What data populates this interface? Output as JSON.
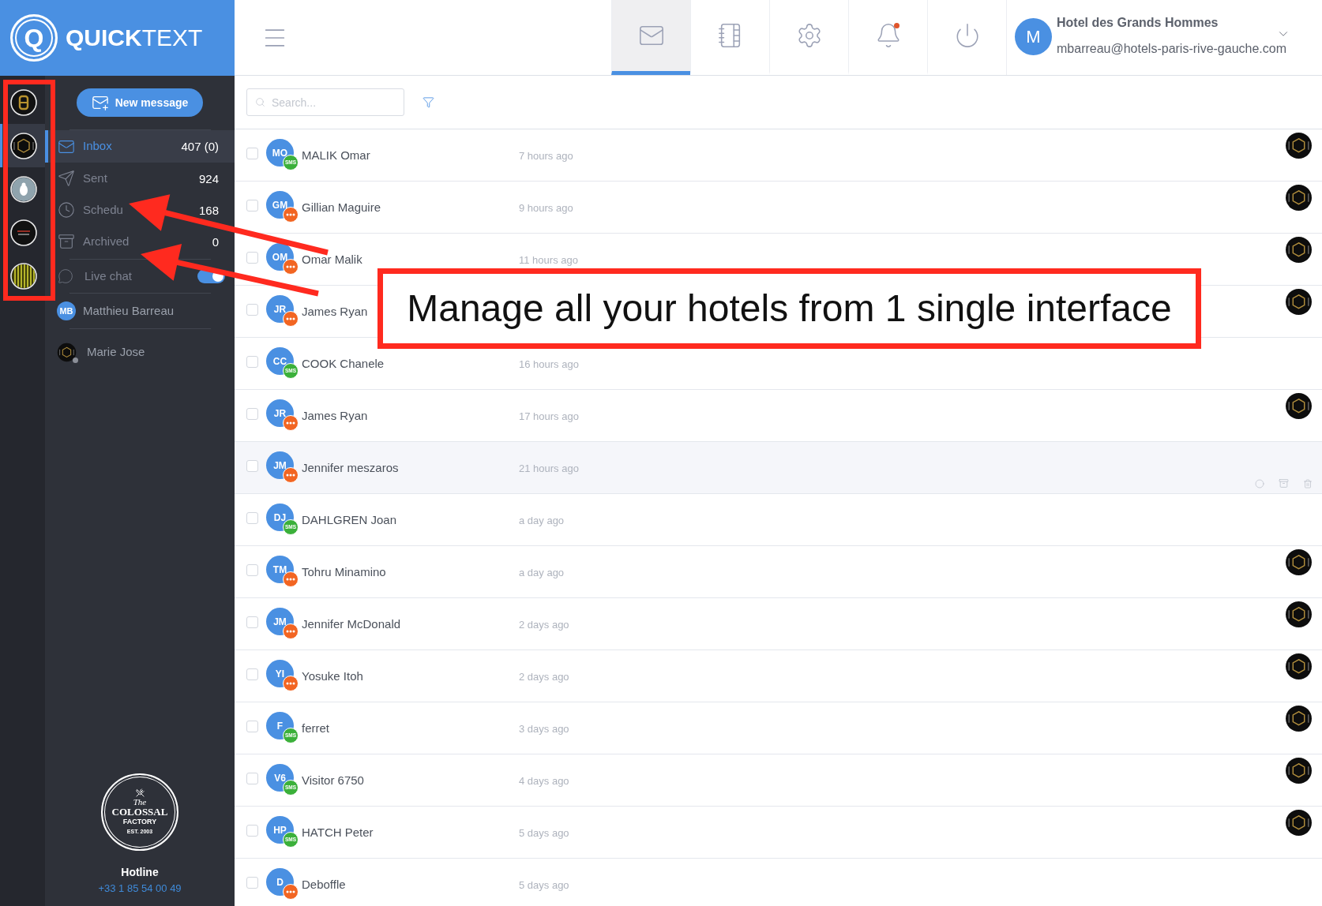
{
  "brand": {
    "mark": "Q",
    "name": "**QUICK**TEXT"
  },
  "hotels": [
    {
      "kind": "monogram",
      "selected": false
    },
    {
      "kind": "hexagon",
      "selected": true
    },
    {
      "kind": "figure",
      "selected": false
    },
    {
      "kind": "script",
      "selected": false
    },
    {
      "kind": "stripes",
      "selected": false
    }
  ],
  "sidebar": {
    "new_message": "New message",
    "folders": [
      {
        "kind": "inbox",
        "label": "Inbox",
        "count": "407 (0)",
        "selected": true
      },
      {
        "kind": "sent",
        "label": "Sent",
        "count": "924",
        "selected": false
      },
      {
        "kind": "scheduled",
        "label": "Schedu",
        "count": "168",
        "selected": false
      },
      {
        "kind": "archived",
        "label": "Archived",
        "count": "0",
        "selected": false
      }
    ],
    "live_chat": {
      "label": "Live chat",
      "on": true
    },
    "agents": [
      {
        "kind": "initials",
        "initials": "MB",
        "name": "Matthieu Barreau",
        "status_dot": false
      },
      {
        "kind": "logo",
        "name": "Marie Jose",
        "status_dot": true
      }
    ],
    "footer_logo": {
      "script": "The",
      "name": "COLOSSAL",
      "sub": "FACTORY",
      "est": "EST. 2003"
    },
    "hotline": {
      "label": "Hotline",
      "phone": "+33 1 85 54 00 49"
    }
  },
  "topbar": {
    "tabs": [
      {
        "kind": "mail",
        "selected": true,
        "alert": false
      },
      {
        "kind": "notebook",
        "selected": false,
        "alert": false
      },
      {
        "kind": "settings",
        "selected": false,
        "alert": false
      },
      {
        "kind": "bell",
        "selected": false,
        "alert": true
      },
      {
        "kind": "power",
        "selected": false,
        "alert": false
      }
    ],
    "account": {
      "initial": "M",
      "hotel": "Hotel des Grands Hommes",
      "email": "mbarreau@hotels-paris-rive-gauche.com"
    }
  },
  "search": {
    "placeholder": "Search..."
  },
  "messages": [
    {
      "initials": "MO",
      "name": "MALIK Omar",
      "time": "7 hours ago",
      "channel": {
        "kind": "sms",
        "label": "SMS"
      },
      "checked": false,
      "highlighted": false,
      "assigned_logo": true
    },
    {
      "initials": "GM",
      "name": "Gillian Maguire",
      "time": "9 hours ago",
      "channel": {
        "kind": "chat"
      },
      "checked": false,
      "highlighted": false,
      "assigned_logo": true
    },
    {
      "initials": "OM",
      "name": "Omar Malik",
      "time": "11 hours ago",
      "channel": {
        "kind": "chat"
      },
      "checked": false,
      "highlighted": false,
      "assigned_logo": true
    },
    {
      "initials": "JR",
      "name": "James Ryan",
      "channel": {
        "kind": "chat"
      },
      "checked": false,
      "highlighted": false,
      "assigned_logo": true
    },
    {
      "initials": "CC",
      "name": "COOK Chanele",
      "time": "16 hours ago",
      "channel": {
        "kind": "sms",
        "label": "SMS"
      },
      "checked": false,
      "highlighted": false,
      "assigned_logo": false
    },
    {
      "initials": "JR",
      "name": "James Ryan",
      "time": "17 hours ago",
      "channel": {
        "kind": "chat"
      },
      "checked": false,
      "highlighted": false,
      "assigned_logo": true
    },
    {
      "initials": "JM",
      "name": "Jennifer meszaros",
      "time": "21 hours ago",
      "channel": {
        "kind": "chat"
      },
      "checked": false,
      "highlighted": true,
      "assigned_logo": false
    },
    {
      "initials": "DJ",
      "name": "DAHLGREN Joan",
      "time": "a day ago",
      "channel": {
        "kind": "sms",
        "label": "SMS"
      },
      "checked": false,
      "highlighted": false,
      "assigned_logo": false
    },
    {
      "initials": "TM",
      "name": "Tohru Minamino",
      "time": "a day ago",
      "channel": {
        "kind": "chat"
      },
      "checked": false,
      "highlighted": false,
      "assigned_logo": true
    },
    {
      "initials": "JM",
      "name": "Jennifer McDonald",
      "time": "2 days ago",
      "channel": {
        "kind": "chat"
      },
      "checked": false,
      "highlighted": false,
      "assigned_logo": true
    },
    {
      "initials": "YI",
      "name": "Yosuke Itoh",
      "time": "2 days ago",
      "channel": {
        "kind": "chat"
      },
      "checked": false,
      "highlighted": false,
      "assigned_logo": true
    },
    {
      "initials": "F",
      "name": "ferret",
      "time": "3 days ago",
      "channel": {
        "kind": "sms",
        "label": "SMS"
      },
      "checked": false,
      "highlighted": false,
      "assigned_logo": true
    },
    {
      "initials": "V6",
      "name": "Visitor 6750",
      "time": "4 days ago",
      "channel": {
        "kind": "sms",
        "label": "SMS"
      },
      "checked": false,
      "highlighted": false,
      "assigned_logo": true
    },
    {
      "initials": "HP",
      "name": "HATCH Peter",
      "time": "5 days ago",
      "channel": {
        "kind": "sms",
        "label": "SMS"
      },
      "checked": false,
      "highlighted": false,
      "assigned_logo": true
    },
    {
      "initials": "D",
      "name": "Deboffle",
      "time": "5 days ago",
      "channel": {
        "kind": "chat"
      },
      "checked": false,
      "highlighted": false,
      "assigned_logo": false
    }
  ],
  "annotation": {
    "text": "Manage all your hotels from 1 single interface"
  }
}
